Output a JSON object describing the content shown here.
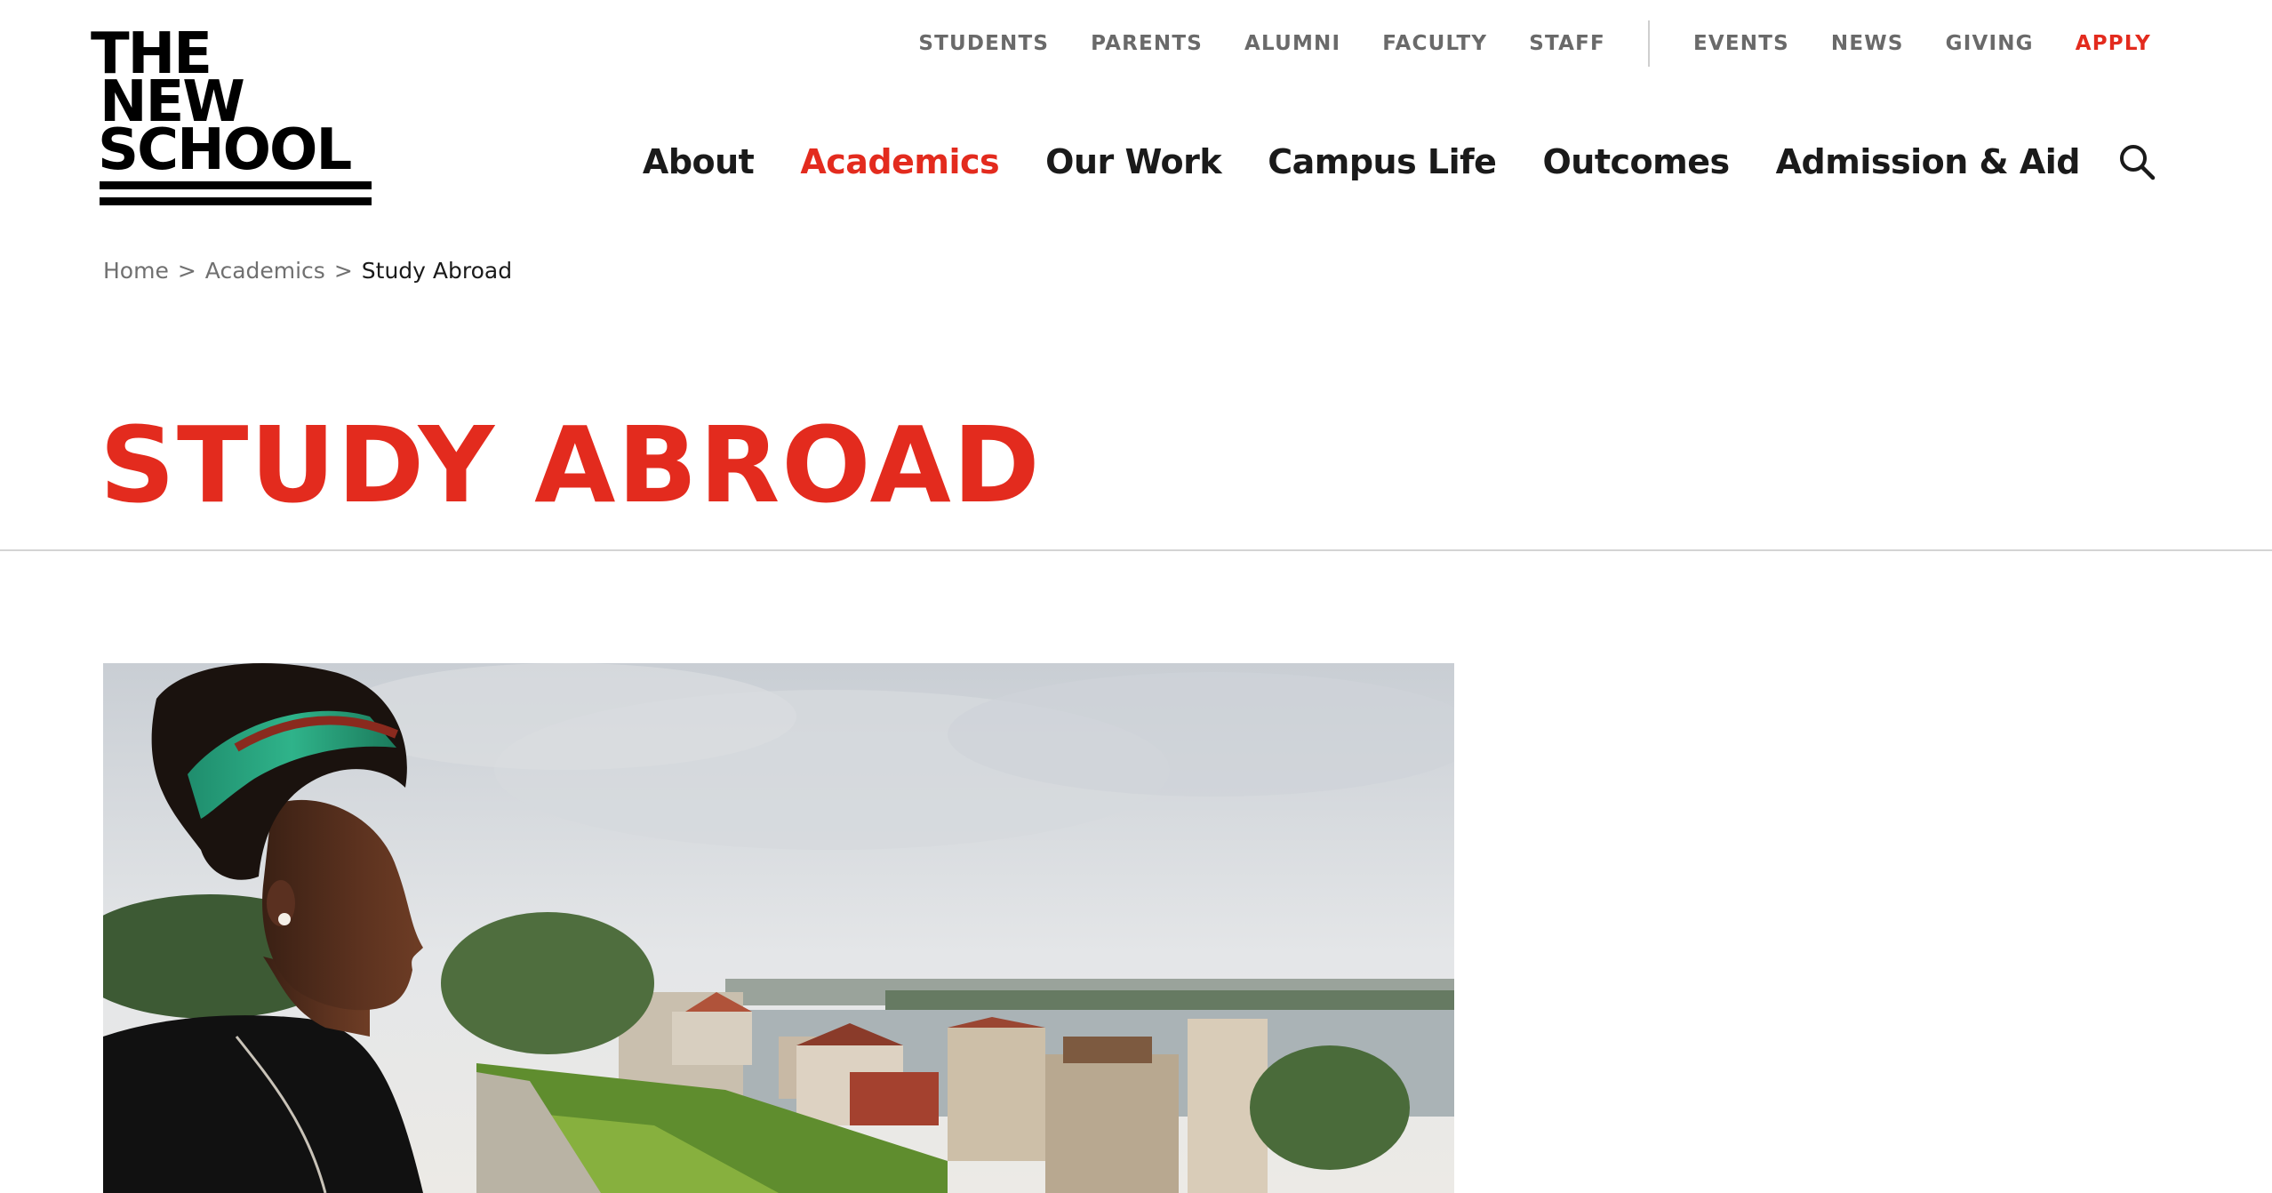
{
  "logo": {
    "lines": [
      "THE",
      "NEW",
      "SCHOOL"
    ]
  },
  "utility_nav": {
    "items": [
      "STUDENTS",
      "PARENTS",
      "ALUMNI",
      "FACULTY",
      "STAFF"
    ],
    "secondary": [
      "EVENTS",
      "NEWS",
      "GIVING"
    ],
    "apply": "APPLY"
  },
  "main_nav": {
    "items": [
      "About",
      "Academics",
      "Our Work",
      "Campus Life",
      "Outcomes",
      "Admission & Aid"
    ],
    "active": "Academics",
    "search_icon": "search-icon"
  },
  "breadcrumb": {
    "items": [
      "Home",
      "Academics"
    ],
    "separator": ">",
    "current": "Study Abroad"
  },
  "page": {
    "title": "STUDY ABROAD"
  },
  "hero": {
    "image_description": ""
  },
  "colors": {
    "accent": "#e32b1e",
    "text": "#1a1a1a",
    "muted": "#6a6a6a",
    "rule": "#d4d4d4"
  }
}
